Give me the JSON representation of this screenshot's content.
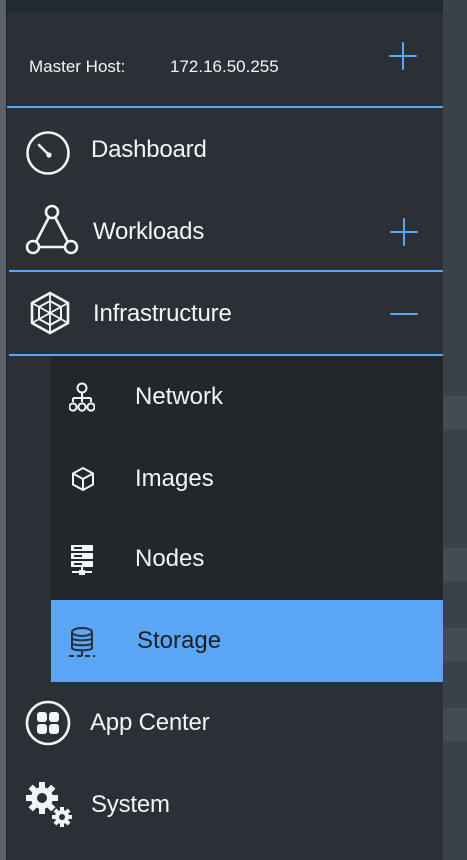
{
  "header": {
    "master_label": "Master Host:",
    "master_ip": "172.16.50.255"
  },
  "nav": {
    "dashboard": "Dashboard",
    "workloads": "Workloads",
    "infrastructure": "Infrastructure",
    "app_center": "App Center",
    "system": "System"
  },
  "infrastructure_sub": {
    "network": "Network",
    "images": "Images",
    "nodes": "Nodes",
    "storage": "Storage"
  },
  "colors": {
    "accent": "#5aa6f5",
    "sidebar_bg": "#2b3036",
    "submenu_bg": "#22272c",
    "text": "#f2f4f6"
  },
  "icons": {
    "dashboard": "gauge-icon",
    "workloads": "network-triangle-icon",
    "infrastructure": "cube-wireframe-icon",
    "network": "org-tree-icon",
    "images": "cube-icon",
    "nodes": "server-rack-icon",
    "storage": "database-icon",
    "app_center": "grid-apps-icon",
    "system": "gears-icon"
  }
}
